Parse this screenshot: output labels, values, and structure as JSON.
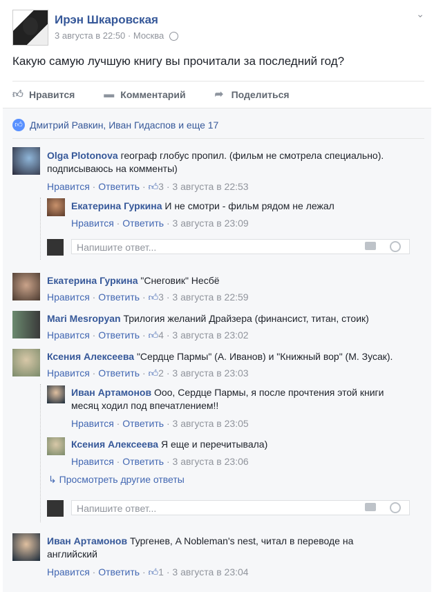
{
  "post": {
    "author": "Ирэн Шкаровская",
    "date": "3 августа в 22:50",
    "location": "Москва",
    "text": "Какую самую лучшую книгу вы прочитали за последний год?"
  },
  "actions": {
    "like": "Нравится",
    "comment": "Комментарий",
    "share": "Поделиться"
  },
  "likes_summary": "Дмитрий Равкин, Иван Гидаспов и еще 17",
  "labels": {
    "like": "Нравится",
    "reply": "Ответить",
    "reply_placeholder": "Напишите ответ...",
    "view_more": "Просмотреть другие ответы"
  },
  "comments": [
    {
      "author": "Olga Plotonova",
      "text": "географ глобус пропил. (фильм не смотрела специально). подписываюсь на комменты)",
      "likes": "3",
      "date": "3 августа в 22:53",
      "replies": [
        {
          "author": "Екатерина Гуркина",
          "text": "И не смотри - фильм рядом не лежал",
          "date": "3 августа в 23:09"
        }
      ]
    },
    {
      "author": "Екатерина Гуркина",
      "text": "\"Снеговик\" Несбё",
      "likes": "3",
      "date": "3 августа в 22:59"
    },
    {
      "author": "Mari Mesropyan",
      "text": "Трилогия желаний Драйзера (финансист, титан, стоик)",
      "likes": "4",
      "date": "3 августа в 23:02"
    },
    {
      "author": "Ксения Алексеева",
      "text": "\"Сердце Пармы\" (А. Иванов) и \"Книжный вор\" (М. Зусак).",
      "likes": "2",
      "date": "3 августа в 23:03",
      "replies": [
        {
          "author": "Иван Артамонов",
          "text": "Ооо, Сердце Пармы, я после прочтения этой книги месяц ходил под впечатлением!!",
          "date": "3 августа в 23:05"
        },
        {
          "author": "Ксения Алексеева",
          "text": "Я еще и перечитывала)",
          "date": "3 августа в 23:06"
        }
      ]
    },
    {
      "author": "Иван Артамонов",
      "text": "Тургенев, A Nobleman's nest, читал в переводе на английский",
      "likes": "1",
      "date": "3 августа в 23:04"
    }
  ]
}
